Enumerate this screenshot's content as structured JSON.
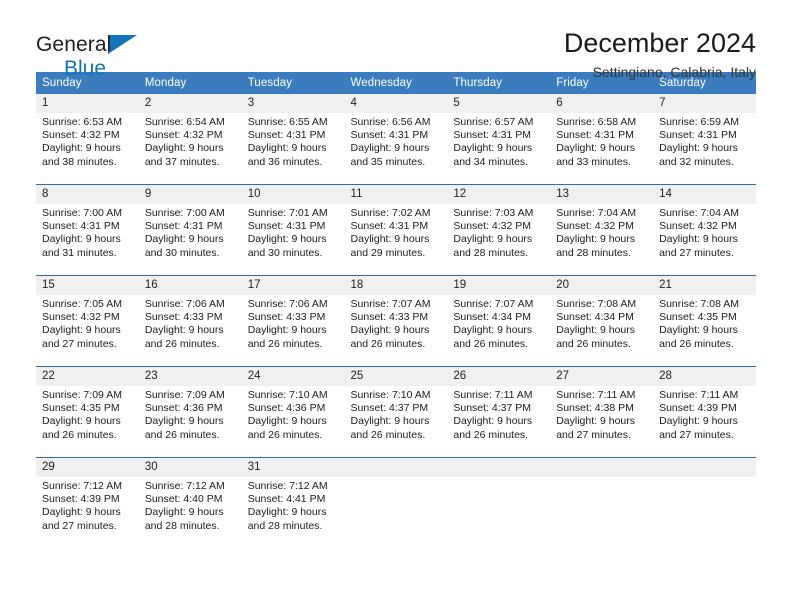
{
  "brand": {
    "name_part1": "General",
    "name_part2": "Blue",
    "flag_icon": "triangle-flag-icon"
  },
  "header": {
    "month_title": "December 2024",
    "location": "Settingiano, Calabria, Italy"
  },
  "colors": {
    "header_blue": "#3b7cbe",
    "row_divider_blue": "#2f6da8",
    "daynum_band": "#f0f0f0",
    "brand_blue": "#1573ba"
  },
  "calendar": {
    "weekday_headers": [
      "Sunday",
      "Monday",
      "Tuesday",
      "Wednesday",
      "Thursday",
      "Friday",
      "Saturday"
    ],
    "weeks": [
      [
        {
          "day": "1",
          "sunrise": "Sunrise: 6:53 AM",
          "sunset": "Sunset: 4:32 PM",
          "daylight_line1": "Daylight: 9 hours",
          "daylight_line2": "and 38 minutes."
        },
        {
          "day": "2",
          "sunrise": "Sunrise: 6:54 AM",
          "sunset": "Sunset: 4:32 PM",
          "daylight_line1": "Daylight: 9 hours",
          "daylight_line2": "and 37 minutes."
        },
        {
          "day": "3",
          "sunrise": "Sunrise: 6:55 AM",
          "sunset": "Sunset: 4:31 PM",
          "daylight_line1": "Daylight: 9 hours",
          "daylight_line2": "and 36 minutes."
        },
        {
          "day": "4",
          "sunrise": "Sunrise: 6:56 AM",
          "sunset": "Sunset: 4:31 PM",
          "daylight_line1": "Daylight: 9 hours",
          "daylight_line2": "and 35 minutes."
        },
        {
          "day": "5",
          "sunrise": "Sunrise: 6:57 AM",
          "sunset": "Sunset: 4:31 PM",
          "daylight_line1": "Daylight: 9 hours",
          "daylight_line2": "and 34 minutes."
        },
        {
          "day": "6",
          "sunrise": "Sunrise: 6:58 AM",
          "sunset": "Sunset: 4:31 PM",
          "daylight_line1": "Daylight: 9 hours",
          "daylight_line2": "and 33 minutes."
        },
        {
          "day": "7",
          "sunrise": "Sunrise: 6:59 AM",
          "sunset": "Sunset: 4:31 PM",
          "daylight_line1": "Daylight: 9 hours",
          "daylight_line2": "and 32 minutes."
        }
      ],
      [
        {
          "day": "8",
          "sunrise": "Sunrise: 7:00 AM",
          "sunset": "Sunset: 4:31 PM",
          "daylight_line1": "Daylight: 9 hours",
          "daylight_line2": "and 31 minutes."
        },
        {
          "day": "9",
          "sunrise": "Sunrise: 7:00 AM",
          "sunset": "Sunset: 4:31 PM",
          "daylight_line1": "Daylight: 9 hours",
          "daylight_line2": "and 30 minutes."
        },
        {
          "day": "10",
          "sunrise": "Sunrise: 7:01 AM",
          "sunset": "Sunset: 4:31 PM",
          "daylight_line1": "Daylight: 9 hours",
          "daylight_line2": "and 30 minutes."
        },
        {
          "day": "11",
          "sunrise": "Sunrise: 7:02 AM",
          "sunset": "Sunset: 4:31 PM",
          "daylight_line1": "Daylight: 9 hours",
          "daylight_line2": "and 29 minutes."
        },
        {
          "day": "12",
          "sunrise": "Sunrise: 7:03 AM",
          "sunset": "Sunset: 4:32 PM",
          "daylight_line1": "Daylight: 9 hours",
          "daylight_line2": "and 28 minutes."
        },
        {
          "day": "13",
          "sunrise": "Sunrise: 7:04 AM",
          "sunset": "Sunset: 4:32 PM",
          "daylight_line1": "Daylight: 9 hours",
          "daylight_line2": "and 28 minutes."
        },
        {
          "day": "14",
          "sunrise": "Sunrise: 7:04 AM",
          "sunset": "Sunset: 4:32 PM",
          "daylight_line1": "Daylight: 9 hours",
          "daylight_line2": "and 27 minutes."
        }
      ],
      [
        {
          "day": "15",
          "sunrise": "Sunrise: 7:05 AM",
          "sunset": "Sunset: 4:32 PM",
          "daylight_line1": "Daylight: 9 hours",
          "daylight_line2": "and 27 minutes."
        },
        {
          "day": "16",
          "sunrise": "Sunrise: 7:06 AM",
          "sunset": "Sunset: 4:33 PM",
          "daylight_line1": "Daylight: 9 hours",
          "daylight_line2": "and 26 minutes."
        },
        {
          "day": "17",
          "sunrise": "Sunrise: 7:06 AM",
          "sunset": "Sunset: 4:33 PM",
          "daylight_line1": "Daylight: 9 hours",
          "daylight_line2": "and 26 minutes."
        },
        {
          "day": "18",
          "sunrise": "Sunrise: 7:07 AM",
          "sunset": "Sunset: 4:33 PM",
          "daylight_line1": "Daylight: 9 hours",
          "daylight_line2": "and 26 minutes."
        },
        {
          "day": "19",
          "sunrise": "Sunrise: 7:07 AM",
          "sunset": "Sunset: 4:34 PM",
          "daylight_line1": "Daylight: 9 hours",
          "daylight_line2": "and 26 minutes."
        },
        {
          "day": "20",
          "sunrise": "Sunrise: 7:08 AM",
          "sunset": "Sunset: 4:34 PM",
          "daylight_line1": "Daylight: 9 hours",
          "daylight_line2": "and 26 minutes."
        },
        {
          "day": "21",
          "sunrise": "Sunrise: 7:08 AM",
          "sunset": "Sunset: 4:35 PM",
          "daylight_line1": "Daylight: 9 hours",
          "daylight_line2": "and 26 minutes."
        }
      ],
      [
        {
          "day": "22",
          "sunrise": "Sunrise: 7:09 AM",
          "sunset": "Sunset: 4:35 PM",
          "daylight_line1": "Daylight: 9 hours",
          "daylight_line2": "and 26 minutes."
        },
        {
          "day": "23",
          "sunrise": "Sunrise: 7:09 AM",
          "sunset": "Sunset: 4:36 PM",
          "daylight_line1": "Daylight: 9 hours",
          "daylight_line2": "and 26 minutes."
        },
        {
          "day": "24",
          "sunrise": "Sunrise: 7:10 AM",
          "sunset": "Sunset: 4:36 PM",
          "daylight_line1": "Daylight: 9 hours",
          "daylight_line2": "and 26 minutes."
        },
        {
          "day": "25",
          "sunrise": "Sunrise: 7:10 AM",
          "sunset": "Sunset: 4:37 PM",
          "daylight_line1": "Daylight: 9 hours",
          "daylight_line2": "and 26 minutes."
        },
        {
          "day": "26",
          "sunrise": "Sunrise: 7:11 AM",
          "sunset": "Sunset: 4:37 PM",
          "daylight_line1": "Daylight: 9 hours",
          "daylight_line2": "and 26 minutes."
        },
        {
          "day": "27",
          "sunrise": "Sunrise: 7:11 AM",
          "sunset": "Sunset: 4:38 PM",
          "daylight_line1": "Daylight: 9 hours",
          "daylight_line2": "and 27 minutes."
        },
        {
          "day": "28",
          "sunrise": "Sunrise: 7:11 AM",
          "sunset": "Sunset: 4:39 PM",
          "daylight_line1": "Daylight: 9 hours",
          "daylight_line2": "and 27 minutes."
        }
      ],
      [
        {
          "day": "29",
          "sunrise": "Sunrise: 7:12 AM",
          "sunset": "Sunset: 4:39 PM",
          "daylight_line1": "Daylight: 9 hours",
          "daylight_line2": "and 27 minutes."
        },
        {
          "day": "30",
          "sunrise": "Sunrise: 7:12 AM",
          "sunset": "Sunset: 4:40 PM",
          "daylight_line1": "Daylight: 9 hours",
          "daylight_line2": "and 28 minutes."
        },
        {
          "day": "31",
          "sunrise": "Sunrise: 7:12 AM",
          "sunset": "Sunset: 4:41 PM",
          "daylight_line1": "Daylight: 9 hours",
          "daylight_line2": "and 28 minutes."
        },
        {
          "day": "",
          "sunrise": "",
          "sunset": "",
          "daylight_line1": "",
          "daylight_line2": ""
        },
        {
          "day": "",
          "sunrise": "",
          "sunset": "",
          "daylight_line1": "",
          "daylight_line2": ""
        },
        {
          "day": "",
          "sunrise": "",
          "sunset": "",
          "daylight_line1": "",
          "daylight_line2": ""
        },
        {
          "day": "",
          "sunrise": "",
          "sunset": "",
          "daylight_line1": "",
          "daylight_line2": ""
        }
      ]
    ]
  }
}
